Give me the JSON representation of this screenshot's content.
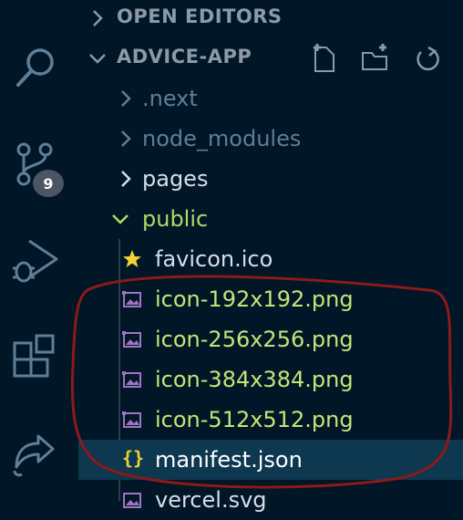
{
  "activity_bar": {
    "icons": [
      "search-icon",
      "source-control-icon",
      "run-debug-icon",
      "extensions-icon",
      "remote-icon"
    ],
    "scm_badge": "9"
  },
  "explorer": {
    "open_editors_title": "OPEN EDITORS",
    "project_title": "ADVICE-APP",
    "actions": [
      "new-file-icon",
      "new-folder-icon",
      "refresh-icon"
    ],
    "tree": [
      {
        "label": ".next",
        "kind": "folder",
        "state": "collapsed",
        "color": "#5f7e97"
      },
      {
        "label": "node_modules",
        "kind": "folder",
        "state": "collapsed",
        "color": "#5f7e97"
      },
      {
        "label": "pages",
        "kind": "folder",
        "state": "collapsed",
        "color": "#d6deeb"
      },
      {
        "label": "public",
        "kind": "folder",
        "state": "expanded",
        "color": "#addb67"
      },
      {
        "label": "favicon.ico",
        "kind": "file",
        "icon": "star-icon",
        "color": "#d6deeb"
      },
      {
        "label": "icon-192x192.png",
        "kind": "file",
        "icon": "image-file-icon",
        "color": "#c5e478"
      },
      {
        "label": "icon-256x256.png",
        "kind": "file",
        "icon": "image-file-icon",
        "color": "#c5e478"
      },
      {
        "label": "icon-384x384.png",
        "kind": "file",
        "icon": "image-file-icon",
        "color": "#c5e478"
      },
      {
        "label": "icon-512x512.png",
        "kind": "file",
        "icon": "image-file-icon",
        "color": "#c5e478"
      },
      {
        "label": "manifest.json",
        "kind": "file",
        "icon": "json-braces-icon",
        "color": "#ffffff",
        "selected": true
      },
      {
        "label": "vercel.svg",
        "kind": "file",
        "icon": "image-file-icon",
        "color": "#d6deeb"
      }
    ]
  },
  "colors": {
    "background": "#011627",
    "selection": "#0e3850",
    "annotation": "#8b1a1a"
  }
}
